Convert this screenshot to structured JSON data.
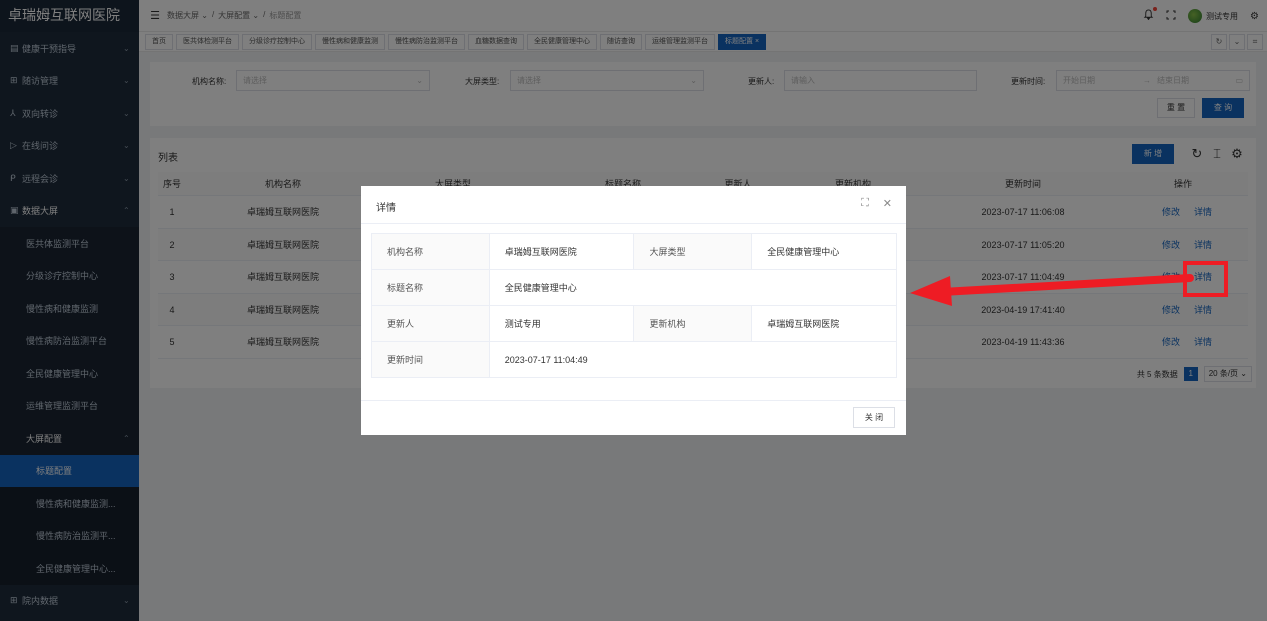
{
  "app": {
    "title": "卓瑞姆互联网医院"
  },
  "sidebar": {
    "items": [
      {
        "icon": "▤",
        "label": "健康干预指导",
        "arrow": "⌄"
      },
      {
        "icon": "⊞",
        "label": "随访管理",
        "arrow": "⌄"
      },
      {
        "icon": "⅄",
        "label": "双向转诊",
        "arrow": "⌄"
      },
      {
        "icon": "▷",
        "label": "在线问诊",
        "arrow": "⌄"
      },
      {
        "icon": "ᑭ",
        "label": "远程会诊",
        "arrow": "⌄"
      },
      {
        "icon": "▣",
        "label": "数据大屏",
        "arrow": "⌃"
      }
    ],
    "sub_items": [
      "医共体监测平台",
      "分级诊疗控制中心",
      "慢性病和健康监测",
      "慢性病防治监测平台",
      "全民健康管理中心",
      "运维管理监测平台"
    ],
    "group": {
      "label": "大屏配置",
      "arrow": "⌃"
    },
    "group_items": [
      "标题配置",
      "慢性病和健康监测...",
      "慢性病防治监测平...",
      "全民健康管理中心..."
    ],
    "last": {
      "icon": "⊞",
      "label": "院内数据",
      "arrow": "⌄"
    }
  },
  "header": {
    "hamburger": "☰",
    "breadcrumb": [
      "数据大屏 ⌄",
      "/",
      "大屏配置 ⌄",
      "/",
      "标题配置"
    ],
    "bell": "🔔",
    "fullscreen": "⛶",
    "user": "测试专用",
    "settings": "⚙"
  },
  "tabs": [
    "首页",
    "医共体检测平台",
    "分级诊疗控制中心",
    "慢性病和健康监测",
    "慢性病防治监测平台",
    "血糖数据查询",
    "全民健康管理中心",
    "随访查询",
    "运维管理监测平台",
    "标题配置 ×"
  ],
  "tab_tools": [
    "↻",
    "⌄",
    "⌗"
  ],
  "filter": {
    "org_label": "机构名称:",
    "org_placeholder": "请选择",
    "type_label": "大屏类型:",
    "type_placeholder": "请选择",
    "updater_label": "更新人:",
    "updater_placeholder": "请输入",
    "time_label": "更新时间:",
    "start_placeholder": "开始日期",
    "range_sep": "→",
    "end_placeholder": "结束日期",
    "reset": "重 置",
    "search": "查 询"
  },
  "list": {
    "title": "列表",
    "add": "新 增",
    "headers": [
      "序号",
      "机构名称",
      "大屏类型",
      "标题名称",
      "更新人",
      "更新机构",
      "更新时间",
      "操作"
    ],
    "rows": [
      {
        "no": "1",
        "org": "卓瑞姆互联网医院",
        "time": "2023-07-17 11:06:08"
      },
      {
        "no": "2",
        "org": "卓瑞姆互联网医院",
        "time": "2023-07-17 11:05:20"
      },
      {
        "no": "3",
        "org": "卓瑞姆互联网医院",
        "time": "2023-07-17 11:04:49"
      },
      {
        "no": "4",
        "org": "卓瑞姆互联网医院",
        "time": "2023-04-19 17:41:40"
      },
      {
        "no": "5",
        "org": "卓瑞姆互联网医院",
        "time": "2023-04-19 11:43:36"
      }
    ],
    "edit": "修改",
    "detail": "详情",
    "total": "共 5 条数据",
    "page": "1",
    "page_size": "20 条/页 ⌄"
  },
  "dialog": {
    "title": "详情",
    "fields": {
      "org_label": "机构名称",
      "org_value": "卓瑞姆互联网医院",
      "type_label": "大屏类型",
      "type_value": "全民健康管理中心",
      "title_label": "标题名称",
      "title_value": "全民健康管理中心",
      "updater_label": "更新人",
      "updater_value": "测试专用",
      "update_org_label": "更新机构",
      "update_org_value": "卓瑞姆互联网医院",
      "time_label": "更新时间",
      "time_value": "2023-07-17 11:04:49"
    },
    "close": "关 闭"
  },
  "colors": {
    "primary": "#1565c0",
    "sidebar": "#1f2d3d",
    "annotation": "#ee1c24"
  }
}
